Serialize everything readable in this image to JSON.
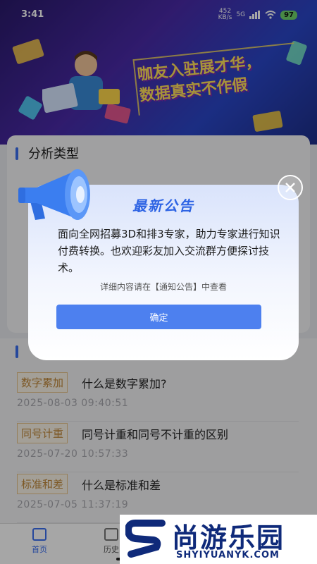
{
  "status": {
    "time": "3:41",
    "net_speed_value": "452",
    "net_speed_unit": "KB/s",
    "signal_label": "5G",
    "battery": "97"
  },
  "banner": {
    "slogan_line1": "咖友入驻展才华，",
    "slogan_line2": "数据真实不作假"
  },
  "card": {
    "section_title": "分析类型"
  },
  "news": [
    {
      "tag": "数字累加",
      "title": "什么是数字累加?",
      "date": "2025-08-03 09:40:51"
    },
    {
      "tag": "同号计重",
      "title": "同号计重和同号不计重的区别",
      "date": "2025-07-20 10:57:33"
    },
    {
      "tag": "标准和差",
      "title": "什么是标准和差",
      "date": "2025-07-05 11:37:19"
    }
  ],
  "tabbar": {
    "home": "首页",
    "history": "历史"
  },
  "dialog": {
    "title": "最新公告",
    "body": "面向全网招募3D和排3专家，助力专家进行知识付费转换。也欢迎彩友加入交流群方便探讨技术。",
    "hint": "详细内容请在【通知公告】中查看",
    "confirm": "确定"
  },
  "watermark": {
    "brand": "尚游乐园",
    "url": "SHYIYUANYK.COM"
  },
  "colors": {
    "accent": "#4d80ef",
    "title_blue": "#2e64e4",
    "tag_border": "#e7c38a",
    "tag_text": "#c0883a"
  },
  "icons": [
    "megaphone-icon",
    "close-icon",
    "home-icon",
    "history-icon",
    "wifi-icon",
    "battery-icon"
  ]
}
